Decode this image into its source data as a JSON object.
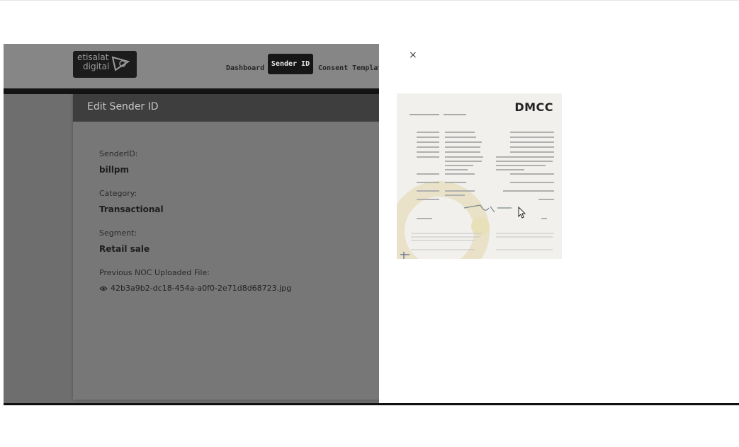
{
  "header": {
    "logo_line1": "etisalat",
    "logo_line2": "digital",
    "nav": {
      "dashboard": "Dashboard",
      "sender_id": "Sender ID",
      "consent_template": "Consent Template"
    }
  },
  "card": {
    "title": "Edit Sender ID",
    "fields": {
      "sender_id_label": "SenderID:",
      "sender_id_value": "billpm",
      "category_label": "Category:",
      "category_value": "Transactional",
      "segment_label": "Segment:",
      "segment_value": "Retail sale",
      "noc_label": "Previous NOC Uploaded File:",
      "noc_filename": "42b3a9b2-dc18-454a-a0f0-2e71d8d68723.jpg"
    }
  },
  "preview": {
    "close_symbol": "×",
    "document_logo": "DMCC"
  },
  "icons": [
    "eye-icon",
    "close-icon",
    "mouse-cursor-icon"
  ],
  "colors": {
    "overlay": "#6e6e6e",
    "header_dark": "#3e3e3e",
    "active_nav": "#161616"
  }
}
